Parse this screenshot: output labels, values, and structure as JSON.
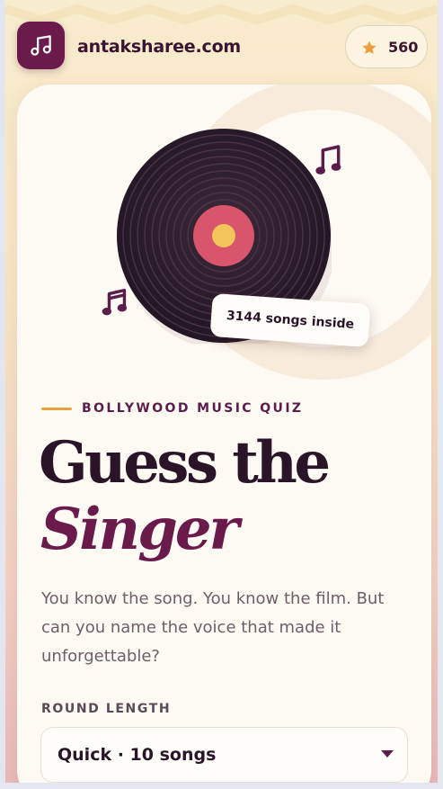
{
  "header": {
    "site_name": "antaksharee.com",
    "logo_icon": "music-note-icon",
    "score": "560",
    "score_icon": "star-icon"
  },
  "hero": {
    "songs_badge": "3144 songs inside",
    "vinyl_icon": "vinyl-record-icon"
  },
  "intro": {
    "kicker": "BOLLYWOOD MUSIC QUIZ",
    "title_line1": "Guess the",
    "title_line2": "Singer",
    "description": "You know the song. You know the film. But can you name the voice that made it unforgettable?"
  },
  "round": {
    "label": "ROUND LENGTH",
    "selected": "Quick · 10 songs"
  },
  "colors": {
    "brand": "#6a1b4b",
    "accent": "#e8a33c",
    "text_dark": "#2a1428",
    "label_pink": "#d9556b",
    "label_yellow": "#f2c45a"
  }
}
